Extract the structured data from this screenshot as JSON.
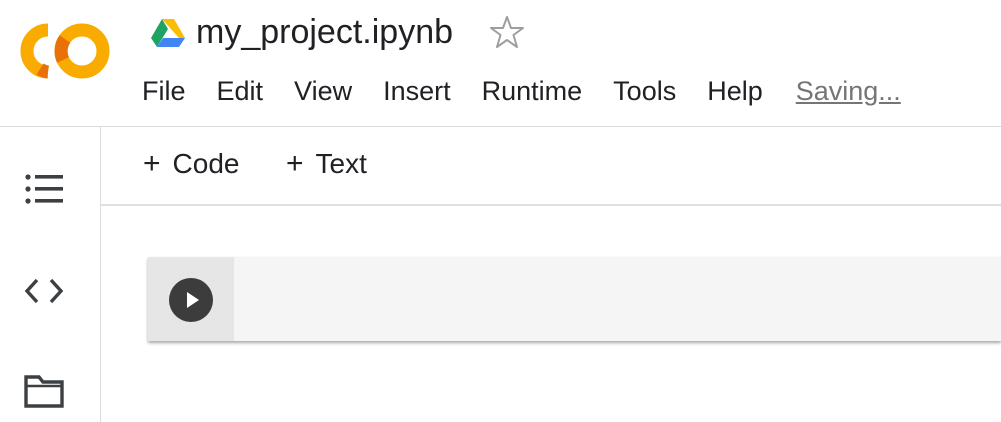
{
  "app": {
    "notebook_title": "my_project.ipynb",
    "status_text": "Saving...",
    "brand_colors": {
      "logo_orange": "#f9ab00",
      "logo_dark_orange": "#e8710a"
    }
  },
  "menu": {
    "items": [
      "File",
      "Edit",
      "View",
      "Insert",
      "Runtime",
      "Tools",
      "Help"
    ]
  },
  "toolbar": {
    "code_label": "Code",
    "text_label": "Text",
    "plus_glyph": "+"
  },
  "left_rail": {
    "icons": [
      "table-of-contents-icon",
      "code-snippets-icon",
      "files-icon"
    ]
  },
  "cell": {
    "type": "code",
    "content": ""
  }
}
